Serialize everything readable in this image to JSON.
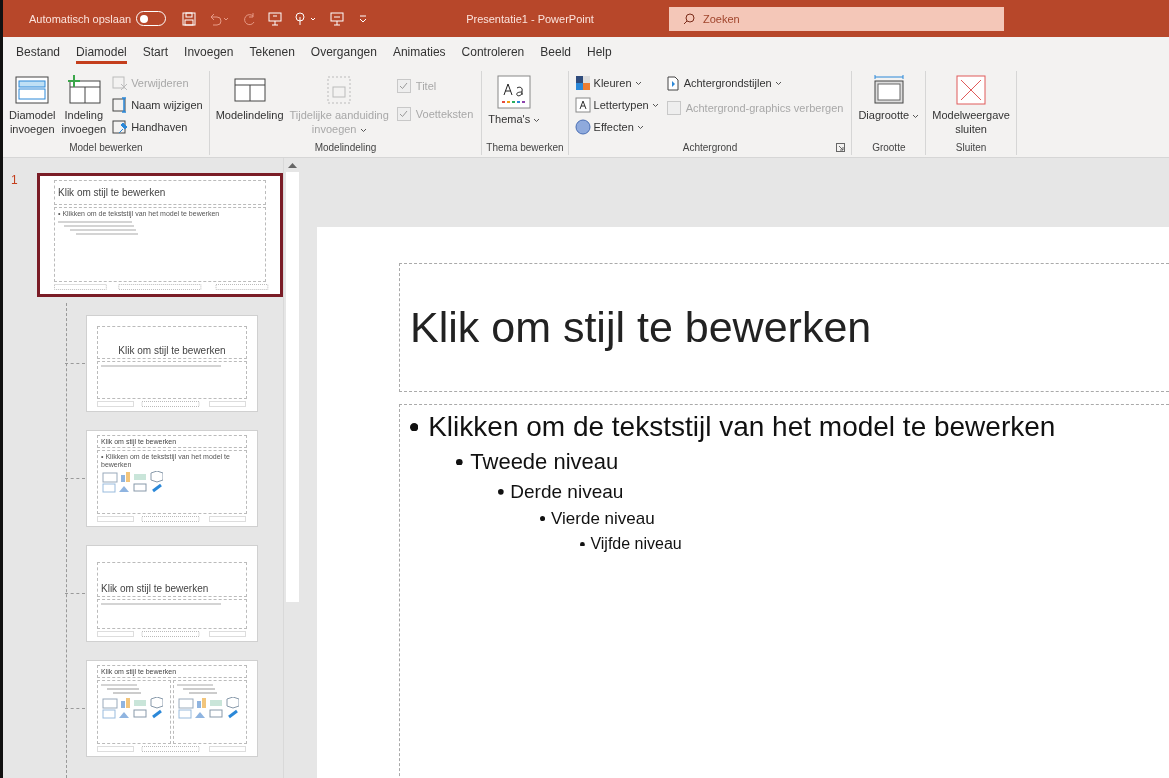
{
  "title_bar": {
    "autosave_label": "Automatisch opslaan",
    "autosave_on": false,
    "title": "Presentatie1  -  PowerPoint",
    "search": {
      "placeholder": "Zoeken"
    }
  },
  "tabs": [
    {
      "label": "Bestand",
      "selected": false
    },
    {
      "label": "Diamodel",
      "selected": true
    },
    {
      "label": "Start",
      "selected": false
    },
    {
      "label": "Invoegen",
      "selected": false
    },
    {
      "label": "Tekenen",
      "selected": false
    },
    {
      "label": "Overgangen",
      "selected": false
    },
    {
      "label": "Animaties",
      "selected": false
    },
    {
      "label": "Controleren",
      "selected": false
    },
    {
      "label": "Beeld",
      "selected": false
    },
    {
      "label": "Help",
      "selected": false
    }
  ],
  "ribbon_groups": [
    {
      "label": "Model bewerken",
      "columns": [
        [
          {
            "kind": "large",
            "label": "Diamodel\ninvoegen",
            "disabled": false
          }
        ],
        [
          {
            "kind": "large",
            "label": "Indeling\ninvoegen",
            "disabled": false
          }
        ],
        [
          {
            "kind": "small",
            "label": "Verwijderen",
            "disabled": true
          },
          {
            "kind": "small",
            "label": "Naam wijzigen",
            "disabled": false
          },
          {
            "kind": "small",
            "label": "Handhaven",
            "disabled": false
          }
        ]
      ]
    },
    {
      "label": "Modelindeling",
      "columns": [
        [
          {
            "kind": "large",
            "label": "Modelindeling",
            "disabled": false
          }
        ],
        [
          {
            "kind": "large",
            "label": "Tijdelijke aanduiding\ninvoegen",
            "disabled": true,
            "dropdown": true
          }
        ],
        [
          {
            "kind": "check",
            "label": "Titel",
            "disabled": true,
            "checked": true
          },
          {
            "kind": "check",
            "label": "Voetteksten",
            "disabled": true,
            "checked": true
          }
        ]
      ]
    },
    {
      "label": "Thema bewerken",
      "columns": [
        [
          {
            "kind": "large",
            "label": "Thema's",
            "disabled": false,
            "dropdown": true
          }
        ]
      ]
    },
    {
      "label": "Achtergrond",
      "launcher": true,
      "columns": [
        [
          {
            "kind": "small",
            "label": "Kleuren",
            "disabled": false,
            "dropdown": true
          },
          {
            "kind": "small",
            "label": "Lettertypen",
            "disabled": false,
            "dropdown": true
          },
          {
            "kind": "small",
            "label": "Effecten",
            "disabled": false,
            "dropdown": true
          }
        ],
        [
          {
            "kind": "small",
            "label": "Achtergrondstijlen",
            "disabled": false,
            "dropdown": true
          },
          {
            "kind": "check",
            "label": "Achtergrond-graphics verbergen",
            "disabled": true,
            "checked": false
          }
        ]
      ]
    },
    {
      "label": "Grootte",
      "columns": [
        [
          {
            "kind": "large",
            "label": "Diagrootte",
            "disabled": false,
            "dropdown": true
          }
        ]
      ]
    },
    {
      "label": "Sluiten",
      "columns": [
        [
          {
            "kind": "large",
            "label": "Modelweergave\nsluiten",
            "disabled": false
          }
        ]
      ]
    }
  ],
  "thumbnails": [
    {
      "kind": "master",
      "number": "1",
      "selected": true,
      "title": "Klik om stijl te bewerken",
      "body": "• Klikken om de tekststijl van het model te bewerken"
    },
    {
      "kind": "title-slide",
      "selected": false,
      "title": "Klik om stijl te bewerken"
    },
    {
      "kind": "content",
      "selected": false,
      "title": "Klik om stijl te bewerken",
      "body": "• Klikken om de tekststijl van het model te bewerken"
    },
    {
      "kind": "section",
      "selected": false,
      "title": "Klik om stijl te bewerken"
    },
    {
      "kind": "two-content",
      "selected": false,
      "title": "Klik om stijl te bewerken"
    }
  ],
  "slide": {
    "title": "Klik om stijl te bewerken",
    "bullets": [
      {
        "text": "Klikken om de tekststijl van het model te bewerken",
        "children": [
          {
            "text": "Tweede niveau",
            "children": [
              {
                "text": "Derde niveau",
                "children": [
                  {
                    "text": "Vierde niveau",
                    "children": [
                      {
                        "text": "Vijfde niveau"
                      }
                    ]
                  }
                ]
              }
            ]
          }
        ]
      }
    ]
  }
}
